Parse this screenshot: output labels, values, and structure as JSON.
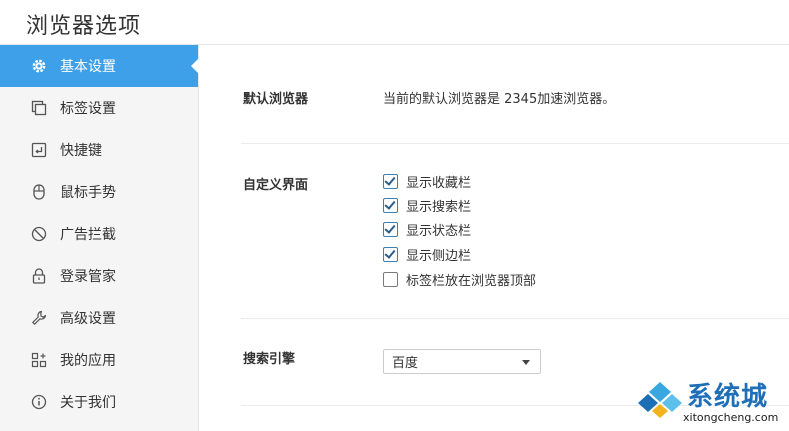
{
  "window": {
    "title": "浏览器选项"
  },
  "sidebar": {
    "items": [
      {
        "label": "基本设置",
        "icon": "gear-icon",
        "active": true
      },
      {
        "label": "标签设置",
        "icon": "tabs-icon",
        "active": false
      },
      {
        "label": "快捷键",
        "icon": "shortcut-key-icon",
        "active": false
      },
      {
        "label": "鼠标手势",
        "icon": "mouse-icon",
        "active": false
      },
      {
        "label": "广告拦截",
        "icon": "block-icon",
        "active": false
      },
      {
        "label": "登录管家",
        "icon": "lock-icon",
        "active": false
      },
      {
        "label": "高级设置",
        "icon": "wrench-icon",
        "active": false
      },
      {
        "label": "我的应用",
        "icon": "apps-grid-icon",
        "active": false
      },
      {
        "label": "关于我们",
        "icon": "info-icon",
        "active": false
      }
    ]
  },
  "default_browser": {
    "label": "默认浏览器",
    "text": "当前的默认浏览器是 2345加速浏览器。"
  },
  "custom_ui": {
    "label": "自定义界面",
    "options": [
      {
        "label": "显示收藏栏",
        "checked": true
      },
      {
        "label": "显示搜索栏",
        "checked": true
      },
      {
        "label": "显示状态栏",
        "checked": true
      },
      {
        "label": "显示侧边栏",
        "checked": true
      },
      {
        "label": "标签栏放在浏览器顶部",
        "checked": false
      }
    ]
  },
  "search_engine": {
    "label": "搜索引擎",
    "selected": "百度"
  },
  "watermark": {
    "brand": "系统城",
    "url": "xitongcheng.com"
  },
  "colors": {
    "accent": "#3fa0ea",
    "sidebar_bg": "#f5f5f5"
  }
}
